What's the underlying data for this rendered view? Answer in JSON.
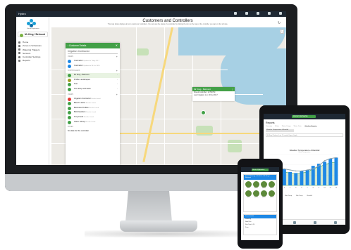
{
  "app": {
    "home_label": "Hydro",
    "org_name": "Hunter Hydrawise",
    "site_name": "Mr King / Belmont"
  },
  "sidebar": {
    "items": [
      {
        "label": "Home"
      },
      {
        "label": "Zones & Schedules"
      },
      {
        "label": "Watering Triggers"
      },
      {
        "label": "Sensors"
      },
      {
        "label": "Controller Settings"
      },
      {
        "label": "Reports"
      }
    ]
  },
  "main": {
    "title": "Customers and Controllers",
    "subtitle": "This map below displays all your customers' controllers. You can view the status of a controller by clicking the icon on the map or the controller you want on the left side."
  },
  "panel": {
    "header": "Customer Details",
    "search": "Irrigation Contractor",
    "users_label": "USERS",
    "users": [
      {
        "name": "Contractor",
        "meta": "Updated at 7 Aug 2017"
      },
      {
        "name": "Contractor",
        "meta": "Updated at 30 Oct 2016"
      }
    ],
    "controllers_label": "CONTROLLERS",
    "controllers": [
      {
        "name": "Mr King - Belmont"
      },
      {
        "name": "Profile Landscapes"
      },
      {
        "name": "Test"
      },
      {
        "name": "The Shop and Deck"
      }
    ],
    "users2_label": "USERS",
    "users2": [
      {
        "name": "Irrigation Contractor",
        "meta": "Results listed"
      },
      {
        "name": "Beech Lawns",
        "meta": "Results Listed"
      },
      {
        "name": "Business Profiles",
        "meta": "Results Listed"
      },
      {
        "name": "Bold Gardens",
        "meta": "Results Listed"
      },
      {
        "name": "Tony Fresh",
        "meta": "Results Listed"
      },
      {
        "name": "Glenn Shoup",
        "meta": "Results Listed"
      }
    ],
    "footer_label": "ZONES",
    "footer_text": "No data for this controller"
  },
  "popup": {
    "title": "Mr King - Belmont",
    "line1": "Speed controller: 12:56 PM",
    "line2": "Last Irrigation run: 28 Jul 2017"
  },
  "tablet": {
    "site": "Hunter Hydrawise",
    "heading": "Reports",
    "tabs": [
      "Overview",
      "Water",
      "Water Usage",
      "Water Data",
      "Weather Reports"
    ],
    "active_tab": "Weather Reports",
    "chip": "Weather Temperature & Rainfall",
    "filter": "Mr King / Belmont   Last 12 months   Export Graph",
    "chart_title": "Weather Temperature & Rainfall",
    "chart_sub": "Mean Temperature",
    "legend": [
      "Max Temp",
      "Min Temp",
      "Rainfall"
    ]
  },
  "phone": {
    "site": "Hunter Hydrawise",
    "card_title": "Zone Watering schedule - Mr King / Belmont",
    "zones": [
      "Zone 1",
      "Zone 2",
      "Zone 3",
      "Zone 4",
      "Zone 5",
      "Zone 6",
      "Zone 7",
      "Zone 8"
    ],
    "detail_title": "Zone Details",
    "detail_lines": [
      "Watering",
      "Next Run",
      "Run Time 1:20",
      "Zone"
    ]
  },
  "chart_data": {
    "type": "bar",
    "categories": [
      "1",
      "2",
      "3",
      "4",
      "5",
      "6",
      "7",
      "8",
      "9",
      "10",
      "11",
      "12"
    ],
    "series": [
      {
        "name": "Max Temp",
        "type": "bar",
        "values": [
          14,
          15,
          16,
          13,
          12,
          14,
          15,
          19,
          21,
          23,
          26,
          27
        ]
      },
      {
        "name": "Min Temp",
        "type": "line",
        "values": [
          15,
          16,
          16,
          15,
          14,
          14,
          15,
          16,
          19,
          24,
          26,
          27
        ]
      },
      {
        "name": "Rainfall",
        "type": "area",
        "values": [
          13,
          14,
          13,
          12,
          11,
          12,
          13,
          16,
          18,
          20,
          22,
          22
        ]
      }
    ],
    "ylim": [
      0,
      30
    ],
    "colors": {
      "Max Temp": "#1e88e5",
      "Min Temp": "#90a4ae",
      "Rainfall": "#43a047"
    }
  }
}
